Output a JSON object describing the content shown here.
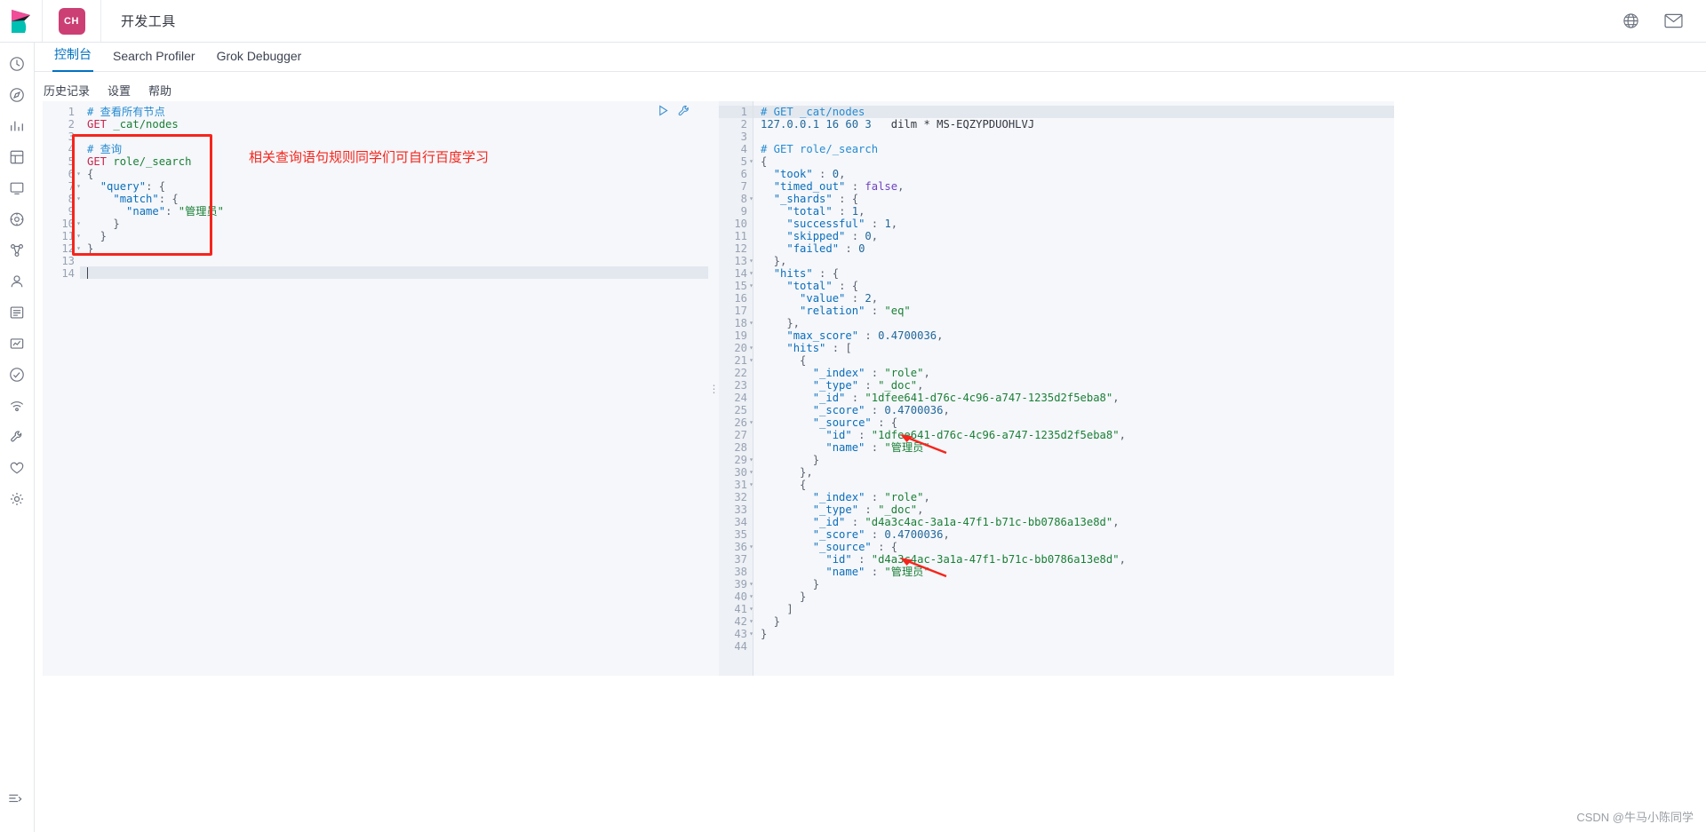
{
  "header": {
    "logo_icon": "kibana-logo",
    "space_badge": "CH",
    "title": "开发工具",
    "globe_icon": "globe-icon",
    "mail_icon": "mail-icon"
  },
  "rail": {
    "items": [
      {
        "icon": "recent-clock-icon",
        "name": "recently-viewed"
      },
      {
        "icon": "compass-icon",
        "name": "discover"
      },
      {
        "icon": "chart-icon",
        "name": "visualize"
      },
      {
        "icon": "dashboard-icon",
        "name": "dashboard"
      },
      {
        "icon": "canvas-icon",
        "name": "canvas"
      },
      {
        "icon": "maps-icon",
        "name": "maps"
      },
      {
        "icon": "ml-icon",
        "name": "machine-learning"
      },
      {
        "icon": "user-icon",
        "name": "infrastructure"
      },
      {
        "icon": "logs-icon",
        "name": "logs"
      },
      {
        "icon": "apm-icon",
        "name": "apm"
      },
      {
        "icon": "uptime-icon",
        "name": "uptime"
      },
      {
        "icon": "siem-icon",
        "name": "siem"
      },
      {
        "icon": "devtools-icon",
        "name": "dev-tools"
      },
      {
        "icon": "monitoring-icon",
        "name": "monitoring"
      },
      {
        "icon": "gear-icon",
        "name": "management"
      }
    ],
    "collapse_icon": "collapse-nav-icon"
  },
  "tabs": [
    {
      "label": "控制台",
      "active": true
    },
    {
      "label": "Search Profiler",
      "active": false
    },
    {
      "label": "Grok Debugger",
      "active": false
    }
  ],
  "subnav": [
    {
      "label": "历史记录"
    },
    {
      "label": "设置"
    },
    {
      "label": "帮助"
    }
  ],
  "editor_actions": {
    "run_icon": "play-run-icon",
    "wrench_icon": "wrench-icon"
  },
  "request_editor": {
    "line_count": 14,
    "cursor_line": 14,
    "lines": [
      {
        "n": 1,
        "tokens": [
          {
            "t": "# 查看所有节点",
            "c": "c-comment"
          }
        ]
      },
      {
        "n": 2,
        "tokens": [
          {
            "t": "GET",
            "c": "c-method"
          },
          {
            "t": " ",
            "c": "c-plain"
          },
          {
            "t": "_cat/nodes",
            "c": "c-url"
          }
        ]
      },
      {
        "n": 3,
        "tokens": []
      },
      {
        "n": 4,
        "tokens": [
          {
            "t": "# 查询",
            "c": "c-comment"
          }
        ]
      },
      {
        "n": 5,
        "tokens": [
          {
            "t": "GET",
            "c": "c-method"
          },
          {
            "t": " ",
            "c": "c-plain"
          },
          {
            "t": "role/_search",
            "c": "c-url"
          }
        ]
      },
      {
        "n": 6,
        "fold": true,
        "tokens": [
          {
            "t": "{",
            "c": "c-punct"
          }
        ]
      },
      {
        "n": 7,
        "fold": true,
        "tokens": [
          {
            "t": "  ",
            "c": "c-plain"
          },
          {
            "t": "\"query\"",
            "c": "c-key"
          },
          {
            "t": ": {",
            "c": "c-punct"
          }
        ]
      },
      {
        "n": 8,
        "fold": true,
        "tokens": [
          {
            "t": "    ",
            "c": "c-plain"
          },
          {
            "t": "\"match\"",
            "c": "c-key"
          },
          {
            "t": ": {",
            "c": "c-punct"
          }
        ]
      },
      {
        "n": 9,
        "tokens": [
          {
            "t": "      ",
            "c": "c-plain"
          },
          {
            "t": "\"name\"",
            "c": "c-key"
          },
          {
            "t": ": ",
            "c": "c-punct"
          },
          {
            "t": "\"管理员\"",
            "c": "c-str"
          }
        ]
      },
      {
        "n": 10,
        "fold": true,
        "tokens": [
          {
            "t": "    }",
            "c": "c-punct"
          }
        ]
      },
      {
        "n": 11,
        "fold": true,
        "tokens": [
          {
            "t": "  }",
            "c": "c-punct"
          }
        ]
      },
      {
        "n": 12,
        "fold": true,
        "tokens": [
          {
            "t": "}",
            "c": "c-punct"
          }
        ]
      },
      {
        "n": 13,
        "tokens": []
      },
      {
        "n": 14,
        "tokens": []
      }
    ]
  },
  "response_editor": {
    "line_count": 44,
    "lines": [
      {
        "n": 1,
        "hl": true,
        "tokens": [
          {
            "t": "# GET _cat/nodes",
            "c": "c-comment"
          }
        ]
      },
      {
        "n": 2,
        "tokens": [
          {
            "t": "127.0.0.1 16 60 3",
            "c": "c-num"
          },
          {
            "t": "   dilm * MS-EQZYPDUOHLVJ",
            "c": "c-plain"
          }
        ]
      },
      {
        "n": 3,
        "tokens": []
      },
      {
        "n": 4,
        "tokens": [
          {
            "t": "# GET role/_search",
            "c": "c-comment"
          }
        ]
      },
      {
        "n": 5,
        "fold": true,
        "tokens": [
          {
            "t": "{",
            "c": "c-punct"
          }
        ]
      },
      {
        "n": 6,
        "tokens": [
          {
            "t": "  ",
            "c": "c-plain"
          },
          {
            "t": "\"took\"",
            "c": "c-key"
          },
          {
            "t": " : ",
            "c": "c-punct"
          },
          {
            "t": "0",
            "c": "c-num"
          },
          {
            "t": ",",
            "c": "c-punct"
          }
        ]
      },
      {
        "n": 7,
        "tokens": [
          {
            "t": "  ",
            "c": "c-plain"
          },
          {
            "t": "\"timed_out\"",
            "c": "c-key"
          },
          {
            "t": " : ",
            "c": "c-punct"
          },
          {
            "t": "false",
            "c": "c-bool"
          },
          {
            "t": ",",
            "c": "c-punct"
          }
        ]
      },
      {
        "n": 8,
        "fold": true,
        "tokens": [
          {
            "t": "  ",
            "c": "c-plain"
          },
          {
            "t": "\"_shards\"",
            "c": "c-key"
          },
          {
            "t": " : {",
            "c": "c-punct"
          }
        ]
      },
      {
        "n": 9,
        "tokens": [
          {
            "t": "    ",
            "c": "c-plain"
          },
          {
            "t": "\"total\"",
            "c": "c-key"
          },
          {
            "t": " : ",
            "c": "c-punct"
          },
          {
            "t": "1",
            "c": "c-num"
          },
          {
            "t": ",",
            "c": "c-punct"
          }
        ]
      },
      {
        "n": 10,
        "tokens": [
          {
            "t": "    ",
            "c": "c-plain"
          },
          {
            "t": "\"successful\"",
            "c": "c-key"
          },
          {
            "t": " : ",
            "c": "c-punct"
          },
          {
            "t": "1",
            "c": "c-num"
          },
          {
            "t": ",",
            "c": "c-punct"
          }
        ]
      },
      {
        "n": 11,
        "tokens": [
          {
            "t": "    ",
            "c": "c-plain"
          },
          {
            "t": "\"skipped\"",
            "c": "c-key"
          },
          {
            "t": " : ",
            "c": "c-punct"
          },
          {
            "t": "0",
            "c": "c-num"
          },
          {
            "t": ",",
            "c": "c-punct"
          }
        ]
      },
      {
        "n": 12,
        "tokens": [
          {
            "t": "    ",
            "c": "c-plain"
          },
          {
            "t": "\"failed\"",
            "c": "c-key"
          },
          {
            "t": " : ",
            "c": "c-punct"
          },
          {
            "t": "0",
            "c": "c-num"
          }
        ]
      },
      {
        "n": 13,
        "fold": true,
        "tokens": [
          {
            "t": "  },",
            "c": "c-punct"
          }
        ]
      },
      {
        "n": 14,
        "fold": true,
        "tokens": [
          {
            "t": "  ",
            "c": "c-plain"
          },
          {
            "t": "\"hits\"",
            "c": "c-key"
          },
          {
            "t": " : {",
            "c": "c-punct"
          }
        ]
      },
      {
        "n": 15,
        "fold": true,
        "tokens": [
          {
            "t": "    ",
            "c": "c-plain"
          },
          {
            "t": "\"total\"",
            "c": "c-key"
          },
          {
            "t": " : {",
            "c": "c-punct"
          }
        ]
      },
      {
        "n": 16,
        "tokens": [
          {
            "t": "      ",
            "c": "c-plain"
          },
          {
            "t": "\"value\"",
            "c": "c-key"
          },
          {
            "t": " : ",
            "c": "c-punct"
          },
          {
            "t": "2",
            "c": "c-num"
          },
          {
            "t": ",",
            "c": "c-punct"
          }
        ]
      },
      {
        "n": 17,
        "tokens": [
          {
            "t": "      ",
            "c": "c-plain"
          },
          {
            "t": "\"relation\"",
            "c": "c-key"
          },
          {
            "t": " : ",
            "c": "c-punct"
          },
          {
            "t": "\"eq\"",
            "c": "c-str"
          }
        ]
      },
      {
        "n": 18,
        "fold": true,
        "tokens": [
          {
            "t": "    },",
            "c": "c-punct"
          }
        ]
      },
      {
        "n": 19,
        "tokens": [
          {
            "t": "    ",
            "c": "c-plain"
          },
          {
            "t": "\"max_score\"",
            "c": "c-key"
          },
          {
            "t": " : ",
            "c": "c-punct"
          },
          {
            "t": "0.4700036",
            "c": "c-num"
          },
          {
            "t": ",",
            "c": "c-punct"
          }
        ]
      },
      {
        "n": 20,
        "fold": true,
        "tokens": [
          {
            "t": "    ",
            "c": "c-plain"
          },
          {
            "t": "\"hits\"",
            "c": "c-key"
          },
          {
            "t": " : [",
            "c": "c-punct"
          }
        ]
      },
      {
        "n": 21,
        "fold": true,
        "tokens": [
          {
            "t": "      {",
            "c": "c-punct"
          }
        ]
      },
      {
        "n": 22,
        "tokens": [
          {
            "t": "        ",
            "c": "c-plain"
          },
          {
            "t": "\"_index\"",
            "c": "c-key"
          },
          {
            "t": " : ",
            "c": "c-punct"
          },
          {
            "t": "\"role\"",
            "c": "c-str"
          },
          {
            "t": ",",
            "c": "c-punct"
          }
        ]
      },
      {
        "n": 23,
        "tokens": [
          {
            "t": "        ",
            "c": "c-plain"
          },
          {
            "t": "\"_type\"",
            "c": "c-key"
          },
          {
            "t": " : ",
            "c": "c-punct"
          },
          {
            "t": "\"_doc\"",
            "c": "c-str"
          },
          {
            "t": ",",
            "c": "c-punct"
          }
        ]
      },
      {
        "n": 24,
        "tokens": [
          {
            "t": "        ",
            "c": "c-plain"
          },
          {
            "t": "\"_id\"",
            "c": "c-key"
          },
          {
            "t": " : ",
            "c": "c-punct"
          },
          {
            "t": "\"1dfee641-d76c-4c96-a747-1235d2f5eba8\"",
            "c": "c-str"
          },
          {
            "t": ",",
            "c": "c-punct"
          }
        ]
      },
      {
        "n": 25,
        "tokens": [
          {
            "t": "        ",
            "c": "c-plain"
          },
          {
            "t": "\"_score\"",
            "c": "c-key"
          },
          {
            "t": " : ",
            "c": "c-punct"
          },
          {
            "t": "0.4700036",
            "c": "c-num"
          },
          {
            "t": ",",
            "c": "c-punct"
          }
        ]
      },
      {
        "n": 26,
        "fold": true,
        "tokens": [
          {
            "t": "        ",
            "c": "c-plain"
          },
          {
            "t": "\"_source\"",
            "c": "c-key"
          },
          {
            "t": " : {",
            "c": "c-punct"
          }
        ]
      },
      {
        "n": 27,
        "tokens": [
          {
            "t": "          ",
            "c": "c-plain"
          },
          {
            "t": "\"id\"",
            "c": "c-key"
          },
          {
            "t": " : ",
            "c": "c-punct"
          },
          {
            "t": "\"1dfee641-d76c-4c96-a747-1235d2f5eba8\"",
            "c": "c-str"
          },
          {
            "t": ",",
            "c": "c-punct"
          }
        ]
      },
      {
        "n": 28,
        "tokens": [
          {
            "t": "          ",
            "c": "c-plain"
          },
          {
            "t": "\"name\"",
            "c": "c-key"
          },
          {
            "t": " : ",
            "c": "c-punct"
          },
          {
            "t": "\"管理员\"",
            "c": "c-str"
          }
        ]
      },
      {
        "n": 29,
        "fold": true,
        "tokens": [
          {
            "t": "        }",
            "c": "c-punct"
          }
        ]
      },
      {
        "n": 30,
        "fold": true,
        "tokens": [
          {
            "t": "      },",
            "c": "c-punct"
          }
        ]
      },
      {
        "n": 31,
        "fold": true,
        "tokens": [
          {
            "t": "      {",
            "c": "c-punct"
          }
        ]
      },
      {
        "n": 32,
        "tokens": [
          {
            "t": "        ",
            "c": "c-plain"
          },
          {
            "t": "\"_index\"",
            "c": "c-key"
          },
          {
            "t": " : ",
            "c": "c-punct"
          },
          {
            "t": "\"role\"",
            "c": "c-str"
          },
          {
            "t": ",",
            "c": "c-punct"
          }
        ]
      },
      {
        "n": 33,
        "tokens": [
          {
            "t": "        ",
            "c": "c-plain"
          },
          {
            "t": "\"_type\"",
            "c": "c-key"
          },
          {
            "t": " : ",
            "c": "c-punct"
          },
          {
            "t": "\"_doc\"",
            "c": "c-str"
          },
          {
            "t": ",",
            "c": "c-punct"
          }
        ]
      },
      {
        "n": 34,
        "tokens": [
          {
            "t": "        ",
            "c": "c-plain"
          },
          {
            "t": "\"_id\"",
            "c": "c-key"
          },
          {
            "t": " : ",
            "c": "c-punct"
          },
          {
            "t": "\"d4a3c4ac-3a1a-47f1-b71c-bb0786a13e8d\"",
            "c": "c-str"
          },
          {
            "t": ",",
            "c": "c-punct"
          }
        ]
      },
      {
        "n": 35,
        "tokens": [
          {
            "t": "        ",
            "c": "c-plain"
          },
          {
            "t": "\"_score\"",
            "c": "c-key"
          },
          {
            "t": " : ",
            "c": "c-punct"
          },
          {
            "t": "0.4700036",
            "c": "c-num"
          },
          {
            "t": ",",
            "c": "c-punct"
          }
        ]
      },
      {
        "n": 36,
        "fold": true,
        "tokens": [
          {
            "t": "        ",
            "c": "c-plain"
          },
          {
            "t": "\"_source\"",
            "c": "c-key"
          },
          {
            "t": " : {",
            "c": "c-punct"
          }
        ]
      },
      {
        "n": 37,
        "tokens": [
          {
            "t": "          ",
            "c": "c-plain"
          },
          {
            "t": "\"id\"",
            "c": "c-key"
          },
          {
            "t": " : ",
            "c": "c-punct"
          },
          {
            "t": "\"d4a3c4ac-3a1a-47f1-b71c-bb0786a13e8d\"",
            "c": "c-str"
          },
          {
            "t": ",",
            "c": "c-punct"
          }
        ]
      },
      {
        "n": 38,
        "tokens": [
          {
            "t": "          ",
            "c": "c-plain"
          },
          {
            "t": "\"name\"",
            "c": "c-key"
          },
          {
            "t": " : ",
            "c": "c-punct"
          },
          {
            "t": "\"管理员\"",
            "c": "c-str"
          }
        ]
      },
      {
        "n": 39,
        "fold": true,
        "tokens": [
          {
            "t": "        }",
            "c": "c-punct"
          }
        ]
      },
      {
        "n": 40,
        "fold": true,
        "tokens": [
          {
            "t": "      }",
            "c": "c-punct"
          }
        ]
      },
      {
        "n": 41,
        "fold": true,
        "tokens": [
          {
            "t": "    ]",
            "c": "c-punct"
          }
        ]
      },
      {
        "n": 42,
        "fold": true,
        "tokens": [
          {
            "t": "  }",
            "c": "c-punct"
          }
        ]
      },
      {
        "n": 43,
        "fold": true,
        "tokens": [
          {
            "t": "}",
            "c": "c-punct"
          }
        ]
      },
      {
        "n": 44,
        "tokens": []
      }
    ]
  },
  "annotations": {
    "note_text": "相关查询语句规则同学们可自行百度学习",
    "color": "#f5251c",
    "arrow_count": 2
  },
  "watermark": "CSDN @牛马小陈同学"
}
